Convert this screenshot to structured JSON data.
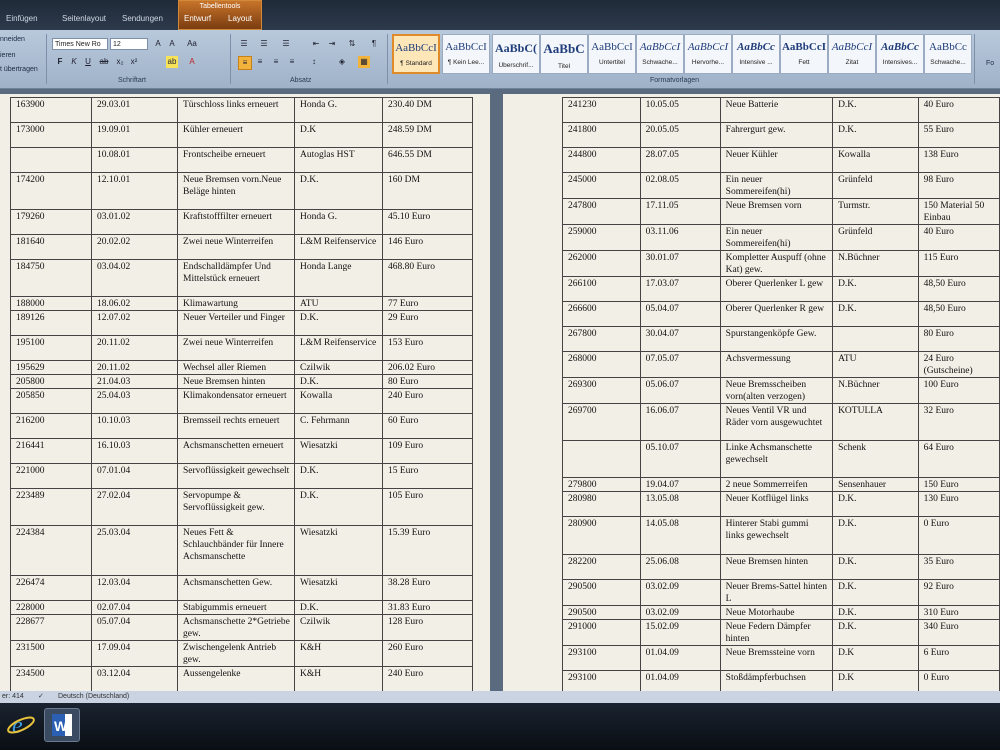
{
  "ribbon": {
    "tabs": [
      "Einfügen",
      "Seitenlayout",
      "Sendungen",
      "Entwurf",
      "Layout"
    ],
    "context_title": "Tabellentools",
    "left_labels": [
      "nneiden",
      "ieren",
      "t übertragen"
    ],
    "font_name": "Times New Ro",
    "font_size": "12",
    "groups": [
      "Schriftart",
      "Absatz",
      "Formatvorlagen"
    ],
    "styles": [
      {
        "sample": "AaBbCcI",
        "name": "¶ Standard"
      },
      {
        "sample": "AaBbCcI",
        "name": "¶ Kein Lee..."
      },
      {
        "sample": "AaBbC(",
        "name": "Überschrif..."
      },
      {
        "sample": "AaBbC",
        "name": "Titel"
      },
      {
        "sample": "AaBbCcI",
        "name": "Untertitel"
      },
      {
        "sample": "AaBbCcI",
        "name": "Schwache..."
      },
      {
        "sample": "AaBbCcI",
        "name": "Hervorhe..."
      },
      {
        "sample": "AaBbCc",
        "name": "Intensive ..."
      },
      {
        "sample": "AaBbCcI",
        "name": "Fett"
      },
      {
        "sample": "AaBbCcI",
        "name": "Zitat"
      },
      {
        "sample": "AaBbCc",
        "name": "Intensives..."
      },
      {
        "sample": "AaBbCc",
        "name": "Schwache..."
      }
    ],
    "right_label": "Fo"
  },
  "status": {
    "words": "er: 414",
    "language": "Deutsch (Deutschland)"
  },
  "page1": {
    "rows": [
      [
        "163900",
        "29.03.01",
        "Türschloss links erneuert",
        "Honda G.",
        "230.40 DM"
      ],
      [
        "173000",
        "19.09.01",
        "Kühler erneuert",
        "D.K",
        "248.59 DM"
      ],
      [
        "",
        "10.08.01",
        "Frontscheibe erneuert",
        "Autoglas HST",
        "646.55 DM"
      ],
      [
        "174200",
        "12.10.01",
        "Neue Bremsen vorn.Neue Beläge hinten",
        "D.K.",
        "160 DM"
      ],
      [
        "179260",
        "03.01.02",
        "Kraftstofffilter erneuert",
        "Honda G.",
        "45.10 Euro"
      ],
      [
        "181640",
        "20.02.02",
        "Zwei neue Winterreifen",
        "L&M Reifenservice",
        "146 Euro"
      ],
      [
        "184750",
        "03.04.02",
        "Endschalldämpfer Und Mittelstück erneuert",
        "Honda Lange",
        "468.80 Euro"
      ],
      [
        "188000",
        "18.06.02",
        "Klimawartung",
        "ATU",
        "77 Euro"
      ],
      [
        "189126",
        "12.07.02",
        "Neuer Verteiler und Finger",
        "D.K.",
        "29 Euro"
      ],
      [
        "195100",
        "20.11.02",
        "Zwei neue Winterreifen",
        "L&M Reifenservice",
        "153 Euro"
      ],
      [
        "195629",
        "20.11.02",
        "Wechsel aller Riemen",
        "Czilwik",
        "206.02 Euro"
      ],
      [
        "205800",
        "21.04.03",
        "Neue Bremsen hinten",
        "D.K.",
        "80 Euro"
      ],
      [
        "205850",
        "25.04.03",
        "Klimakondensator erneuert",
        "Kowalla",
        "240 Euro"
      ],
      [
        "216200",
        "10.10.03",
        "Bremsseil rechts erneuert",
        "C. Fehrmann",
        "60 Euro"
      ],
      [
        "216441",
        "16.10.03",
        "Achsmanschetten erneuert",
        "Wiesatzki",
        "109 Euro"
      ],
      [
        "221000",
        "07.01.04",
        "Servoflüssigkeit gewechselt",
        "D.K.",
        "15 Euro"
      ],
      [
        "223489",
        "27.02.04",
        "Servopumpe & Servoflüssigkeit gew.",
        "D.K.",
        "105 Euro"
      ],
      [
        "224384",
        "25.03.04",
        "Neues Fett & Schlauchbänder für Innere Achsmanschette",
        "Wiesatzki",
        "15.39 Euro"
      ],
      [
        "226474",
        "12.03.04",
        "Achsmanschetten Gew.",
        "Wiesatzki",
        "38.28 Euro"
      ],
      [
        "228000",
        "02.07.04",
        "Stabigummis erneuert",
        "D.K.",
        "31.83 Euro"
      ],
      [
        "228677",
        "05.07.04",
        "Achsmanschette 2*Getriebe gew.",
        "Czilwik",
        "128 Euro"
      ],
      [
        "231500",
        "17.09.04",
        "Zwischengelenk Antrieb gew.",
        "K&H",
        "260 Euro"
      ],
      [
        "234500",
        "03.12.04",
        "Aussengelenke",
        "K&H",
        "240 Euro"
      ]
    ]
  },
  "page2": {
    "rows": [
      [
        "241230",
        "10.05.05",
        "Neue Batterie",
        "D.K.",
        "40 Euro"
      ],
      [
        "241800",
        "20.05.05",
        "Fahrergurt gew.",
        "D.K.",
        "55 Euro"
      ],
      [
        "244800",
        "28.07.05",
        "Neuer Kühler",
        "Kowalla",
        "138 Euro"
      ],
      [
        "245000",
        "02.08.05",
        "Ein neuer Sommereifen(hi)",
        "Grünfeld",
        "98 Euro"
      ],
      [
        "247800",
        "17.11.05",
        "Neue Bremsen vorn",
        "Turmstr.",
        "150 Material 50 Einbau"
      ],
      [
        "259000",
        "03.11.06",
        "Ein neuer Sommereifen(hi)",
        "Grünfeld",
        "40 Euro"
      ],
      [
        "262000",
        "30.01.07",
        "Kompletter Auspuff (ohne Kat) gew.",
        "N.Büchner",
        "115 Euro"
      ],
      [
        "266100",
        "17.03.07",
        "Oberer Querlenker L gew",
        "D.K.",
        "48,50 Euro"
      ],
      [
        "266600",
        "05.04.07",
        "Oberer Querlenker R gew",
        "D.K.",
        "48,50 Euro"
      ],
      [
        "267800",
        "30.04.07",
        "Spurstangenköpfe Gew.",
        "",
        "80 Euro"
      ],
      [
        "268000",
        "07.05.07",
        "Achsvermessung",
        "ATU",
        "24 Euro (Gutscheine)"
      ],
      [
        "269300",
        "05.06.07",
        "Neue Bremsscheiben vorn(alten verzogen)",
        "N.Büchner",
        "100 Euro"
      ],
      [
        "269700",
        "16.06.07",
        "Neues Ventil VR und Räder vorn ausgewuchtet",
        "KOTULLA",
        "32 Euro"
      ],
      [
        "",
        "05.10.07",
        "Linke Achsmanschette gewechselt",
        "Schenk",
        "64 Euro"
      ],
      [
        "279800",
        "19.04.07",
        "2 neue Sommerreifen",
        "Sensenhauer",
        "150 Euro"
      ],
      [
        "280980",
        "13.05.08",
        "Neuer Kotflügel links",
        "D.K.",
        "130 Euro"
      ],
      [
        "280900",
        "14.05.08",
        "Hinterer Stabi gummi links gewechselt",
        "D.K.",
        "0 Euro"
      ],
      [
        "282200",
        "25.06.08",
        "Neue Bremsen hinten",
        "D.K.",
        "35 Euro"
      ],
      [
        "290500",
        "03.02.09",
        "Neuer Brems-Sattel hinten L",
        "D.K.",
        "92 Euro"
      ],
      [
        "290500",
        "03.02.09",
        "Neue Motorhaube",
        "D.K.",
        "310 Euro"
      ],
      [
        "291000",
        "15.02.09",
        "Neue Federn Dämpfer hinten",
        "D.K.",
        "340 Euro"
      ],
      [
        "293100",
        "01.04.09",
        "Neue Bremssteine vorn",
        "D.K",
        "6 Euro"
      ],
      [
        "293100",
        "01.04.09",
        "Stoßdämpferbuchsen",
        "D.K",
        "0 Euro"
      ]
    ]
  }
}
